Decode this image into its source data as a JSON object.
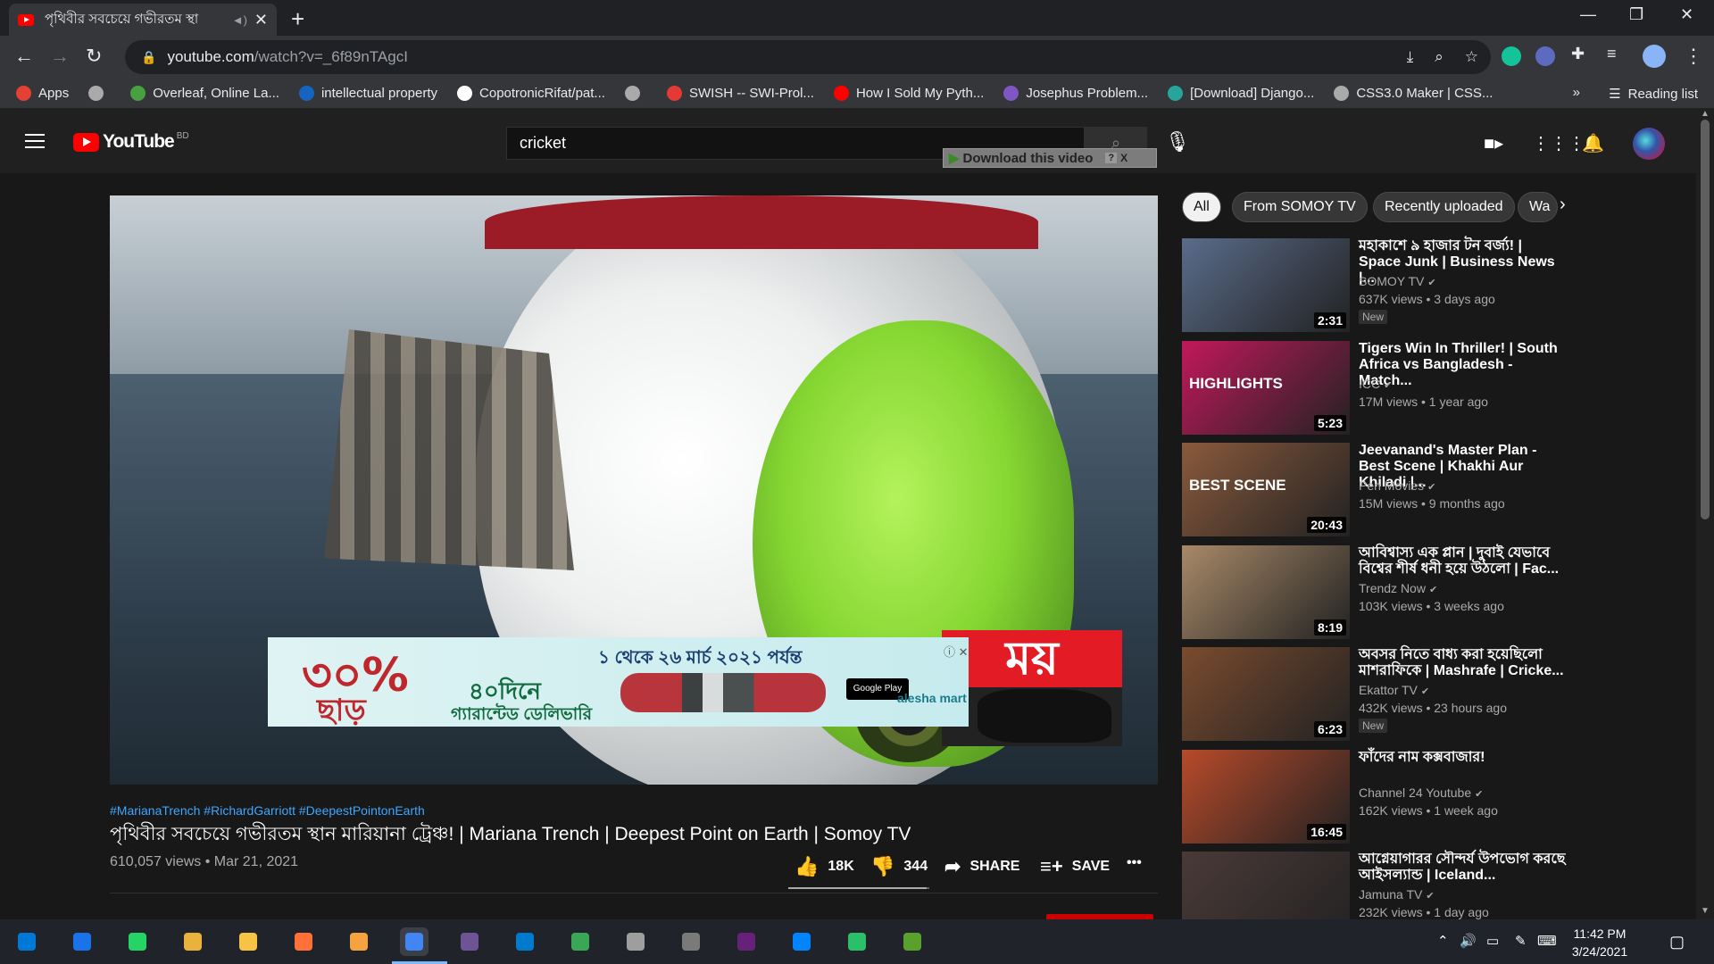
{
  "browser": {
    "tab_title": "পৃথিবীর সবচেয়ে গভীরতম স্থা",
    "tab_close": "✕",
    "url_host": "youtube.com",
    "url_path": "/watch?v=_6f89nTAgcI",
    "bookmarks": [
      {
        "label": "Apps",
        "color": "#e34133"
      },
      {
        "label": "",
        "color": "#aaaaaa"
      },
      {
        "label": "Overleaf, Online La...",
        "color": "#47a141"
      },
      {
        "label": "intellectual property",
        "color": "#1565c0"
      },
      {
        "label": "CopotronicRifat/pat...",
        "color": "#ffffff"
      },
      {
        "label": "",
        "color": "#aaaaaa"
      },
      {
        "label": "SWISH -- SWI-Prol...",
        "color": "#e53935"
      },
      {
        "label": "How I Sold My Pyth...",
        "color": "#ff0000"
      },
      {
        "label": "Josephus Problem...",
        "color": "#7e57c2"
      },
      {
        "label": "[Download] Django...",
        "color": "#26a69a"
      },
      {
        "label": "CSS3.0 Maker | CSS...",
        "color": "#aaaaaa"
      }
    ],
    "more_bookmarks": "»",
    "reading_list": "Reading list"
  },
  "youtube": {
    "logo_text": "YouTube",
    "country": "BD",
    "search_value": "cricket",
    "download_button": "Download this video",
    "download_help": "?",
    "download_close": "X",
    "video": {
      "hashtags": "#MarianaTrench #RichardGarriott #DeepestPointonEarth",
      "title": "পৃথিবীর সবচেয়ে গভীরতম স্থান মারিয়ানা ট্রেঞ্চ! | Mariana Trench | Deepest Point on Earth | Somoy TV",
      "meta": "610,057 views • Mar 21, 2021",
      "likes": "18K",
      "dislikes": "344",
      "share": "SHARE",
      "save": "SAVE",
      "more": "•••",
      "like_ratio": 0.98
    },
    "ad": {
      "discount": "৩০%",
      "discount_word": "ছাড়",
      "top_line": "১ থেকে ২৬ মার্চ ২০২১ পর্যন্ত",
      "mid_line": "৪০দিনে",
      "bottom_line": "গ্যারান্টেড ডেলিভারি",
      "store_badge": "Google Play",
      "brand": "alesha mart",
      "close": "✕"
    },
    "channel_logo_text": "ময়",
    "chips": [
      "All",
      "From SOMOY TV",
      "Recently uploaded",
      "Wa"
    ],
    "related": [
      {
        "title": "মহাকাশে ৯ হাজার টন বর্জ্য! | Space Junk | Business News |...",
        "channel": "SOMOY TV",
        "views": "637K views • 3 days ago",
        "duration": "2:31",
        "badge": "New",
        "thumb": "#5a6c8a"
      },
      {
        "title": "Tigers Win In Thriller! | South Africa vs Bangladesh - Match...",
        "channel": "ICC",
        "views": "17M views • 1 year ago",
        "duration": "5:23",
        "badge": "",
        "thumb": "#c2185b",
        "thumb_text": "HIGHLIGHTS"
      },
      {
        "title": "Jeevanand's Master Plan - Best Scene | Khakhi Aur Khiladi |...",
        "channel": "Pen Movies",
        "views": "15M views • 9 months ago",
        "duration": "20:43",
        "badge": "",
        "thumb": "#8a5a3c",
        "thumb_text": "BEST SCENE"
      },
      {
        "title": "আবিশ্বাস্য এক প্লান | দুবাই যেভাবে বিশ্বের শীর্ষ ধনী হয়ে উঠলো | Fac...",
        "channel": "Trendz Now",
        "views": "103K views • 3 weeks ago",
        "duration": "8:19",
        "badge": "",
        "thumb": "#a88968"
      },
      {
        "title": "অবসর নিতে বাধ্য করা হয়েছিলো মাশরাফিকে | Mashrafe | Cricke...",
        "channel": "Ekattor TV",
        "views": "432K views • 23 hours ago",
        "duration": "6:23",
        "badge": "New",
        "thumb": "#7a4b2e"
      },
      {
        "title": "ফাঁদের নাম কক্সবাজার!",
        "channel": "Channel 24 Youtube",
        "views": "162K views • 1 week ago",
        "duration": "16:45",
        "badge": "",
        "thumb": "#b84a2a"
      },
      {
        "title": "আগ্নেয়াগারর সৌন্দর্য উপভোগ করছে আইসল্যান্ড | Iceland...",
        "channel": "Jamuna TV",
        "views": "232K views • 1 day ago",
        "duration": "",
        "badge": "",
        "thumb": "#4a3a38"
      }
    ]
  },
  "taskbar": {
    "time": "11:42 PM",
    "date": "3/24/2021"
  },
  "colors": {
    "accent": "#ff0000",
    "link": "#3ea6ff"
  }
}
